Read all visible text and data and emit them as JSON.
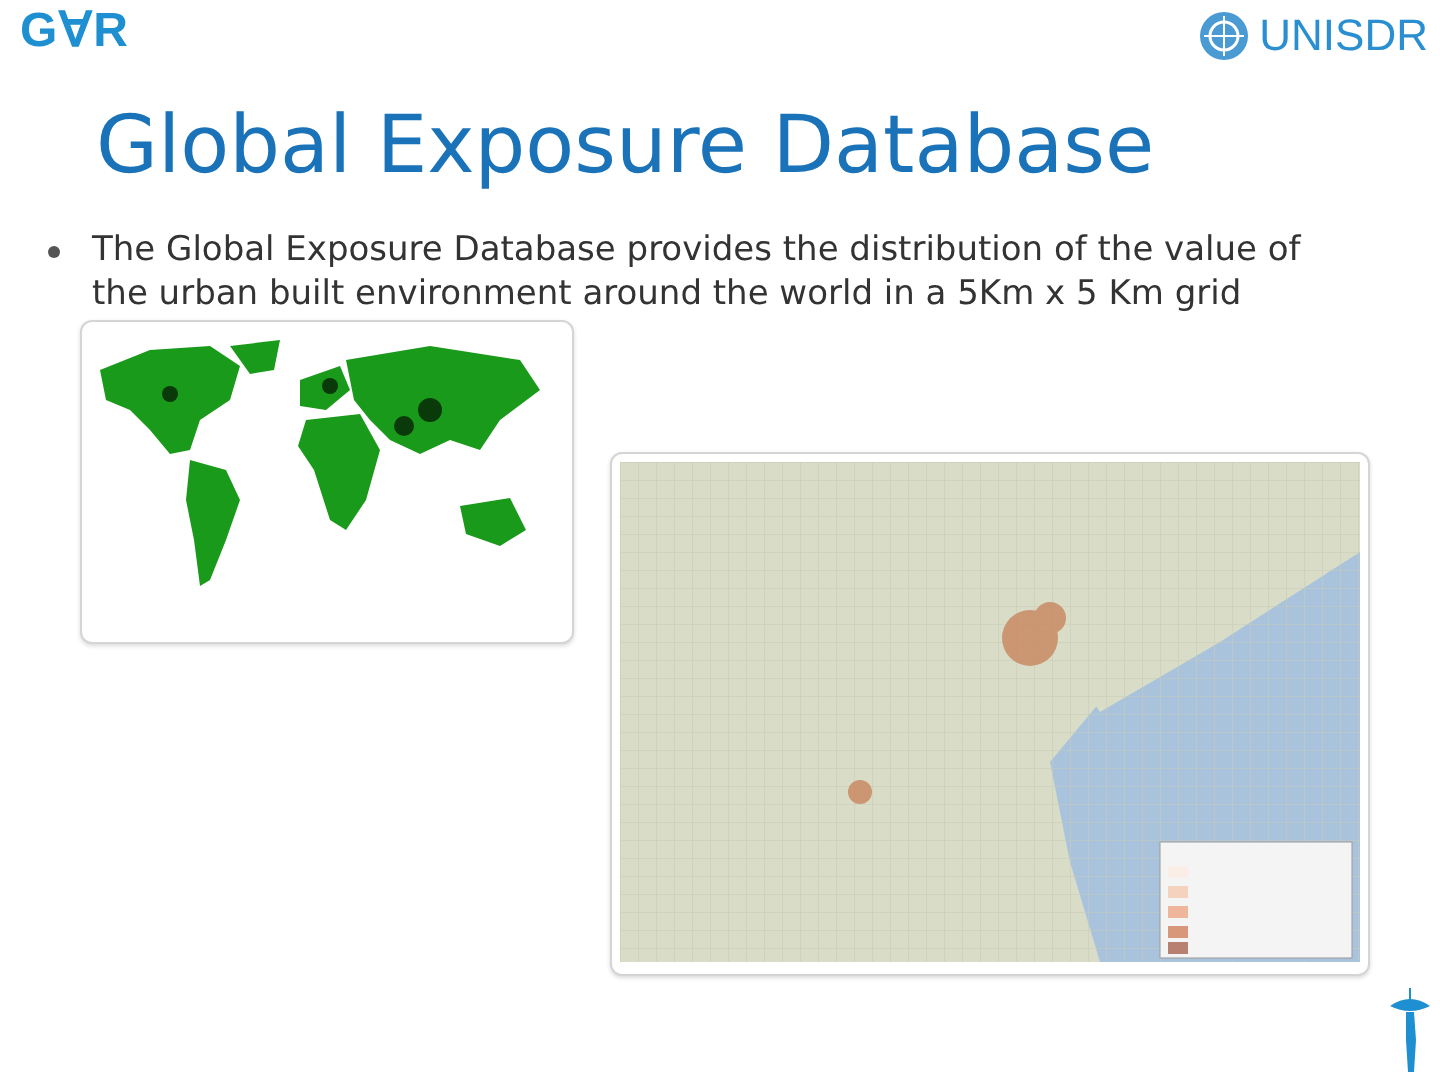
{
  "header": {
    "left_logo": "G∀R",
    "right_logo": "UNISDR"
  },
  "title": "Global Exposure Database",
  "bullets": [
    "The Global Exposure Database provides the distribution of the value of the urban built environment around the world in a 5Km x 5 Km grid"
  ]
}
